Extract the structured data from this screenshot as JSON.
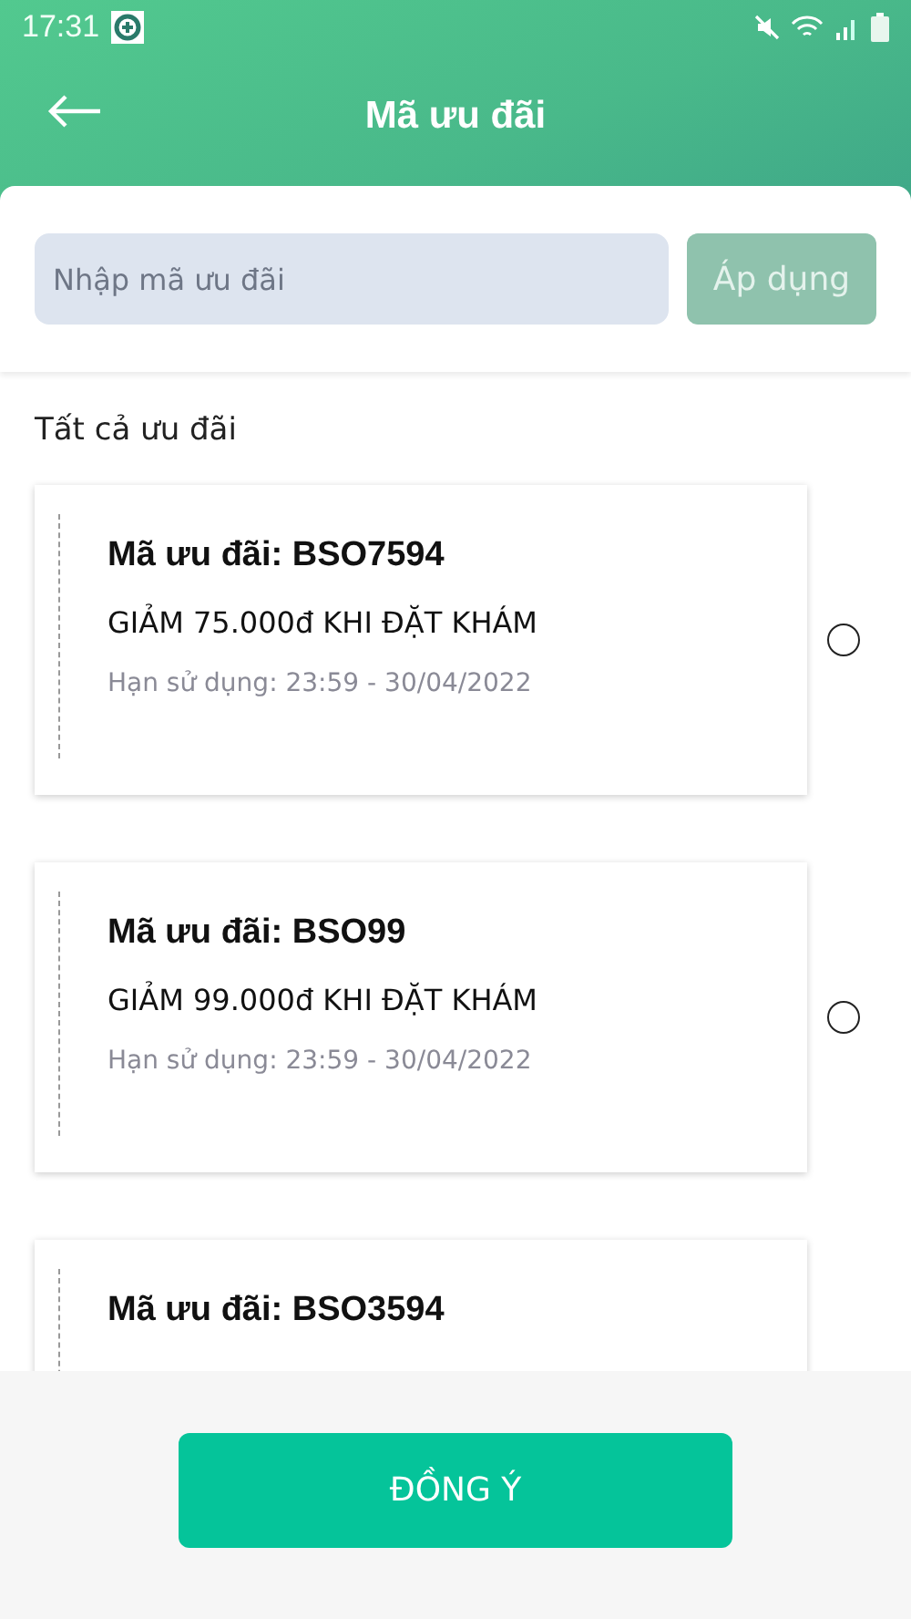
{
  "status_bar": {
    "time": "17:31"
  },
  "header": {
    "title": "Mã ưu đãi"
  },
  "promo_input": {
    "placeholder": "Nhập mã ưu đãi",
    "apply_button": {
      "label": "Áp dụng",
      "disabled": true
    }
  },
  "section_title": "Tất cả ưu đãi",
  "vouchers": [
    {
      "code": "Mã ưu đãi: BSO7594",
      "discount": "GIẢM 75.000đ  KHI ĐẶT KHÁM",
      "expiry": "Hạn sử dụng: 23:59 - 30/04/2022",
      "selected": false
    },
    {
      "code": "Mã ưu đãi: BSO99",
      "discount": "GIẢM 99.000đ  KHI ĐẶT KHÁM",
      "expiry": "Hạn sử dụng: 23:59 - 30/04/2022",
      "selected": false
    },
    {
      "code": "Mã ưu đãi: BSO3594"
    }
  ],
  "confirm_button": "ĐỒNG Ý"
}
